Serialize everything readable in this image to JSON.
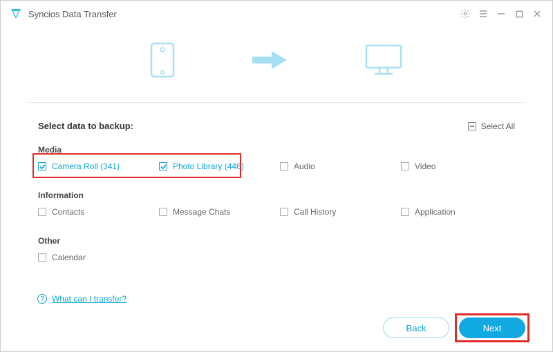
{
  "app_title": "Syncios Data Transfer",
  "select_title": "Select data to backup:",
  "select_all_label": "Select All",
  "sections": {
    "media": {
      "label": "Media"
    },
    "information": {
      "label": "Information"
    },
    "other": {
      "label": "Other"
    }
  },
  "items": {
    "camera_roll": {
      "label": "Camera Roll (341)",
      "checked": true
    },
    "photo_library": {
      "label": "Photo Library (446)",
      "checked": true
    },
    "audio": {
      "label": "Audio",
      "checked": false
    },
    "video": {
      "label": "Video",
      "checked": false
    },
    "contacts": {
      "label": "Contacts",
      "checked": false
    },
    "message_chats": {
      "label": "Message Chats",
      "checked": false
    },
    "call_history": {
      "label": "Call History",
      "checked": false
    },
    "application": {
      "label": "Application",
      "checked": false
    },
    "calendar": {
      "label": "Calendar",
      "checked": false
    }
  },
  "help_link": "What can I transfer?",
  "buttons": {
    "back": "Back",
    "next": "Next"
  }
}
